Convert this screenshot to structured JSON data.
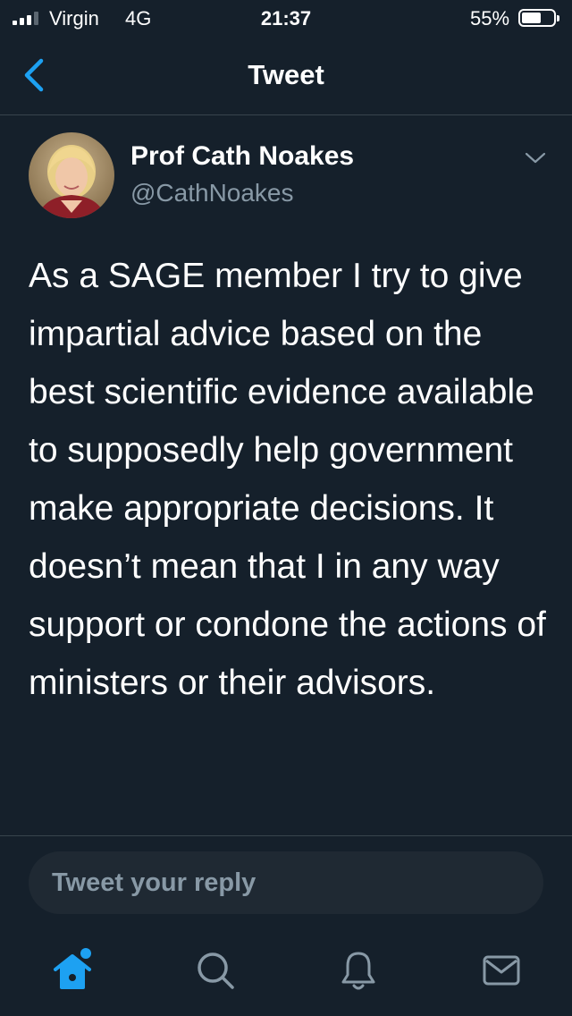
{
  "status_bar": {
    "carrier": "Virgin",
    "network": "4G",
    "time": "21:37",
    "battery_percent": "55%",
    "battery_level": 0.55,
    "signal_bars_active": 3
  },
  "nav": {
    "title": "Tweet",
    "back_icon": "chevron-left-icon"
  },
  "tweet": {
    "author_name": "Prof Cath Noakes",
    "author_handle": "@CathNoakes",
    "text": "As a SAGE member I try to give impartial advice based on the best scientific evidence available to supposedly help government make appropriate decisions. It doesn’t mean that I in any way support or condone the actions of ministers or their advisors."
  },
  "reply": {
    "placeholder": "Tweet your reply"
  },
  "tab_bar": {
    "tabs": [
      {
        "name": "home",
        "icon": "home-icon",
        "active": true
      },
      {
        "name": "search",
        "icon": "search-icon",
        "active": false
      },
      {
        "name": "notifications",
        "icon": "bell-icon",
        "active": false
      },
      {
        "name": "messages",
        "icon": "mail-icon",
        "active": false
      }
    ]
  },
  "colors": {
    "background": "#15202b",
    "accent": "#1da1f2",
    "secondary_text": "#8899a6",
    "divider": "#38444d"
  }
}
